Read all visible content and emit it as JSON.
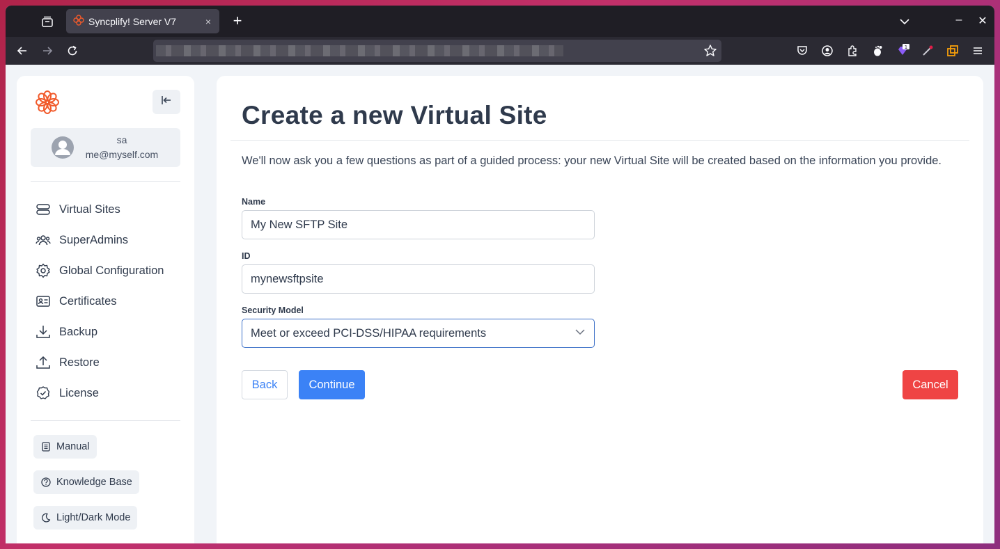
{
  "browser": {
    "tab_title": "Syncplify! Server V7",
    "tab_close": "×",
    "new_tab": "+",
    "minimize": "–",
    "close": "✕",
    "toolbar_icons": [
      "back-icon",
      "forward-icon",
      "reload-icon",
      "bookmark-star-icon",
      "pocket-icon",
      "account-icon",
      "extensions-icon",
      "gnome-icon",
      "extension-badge-icon",
      "extension-pen-icon",
      "extension-copy-icon",
      "menu-icon"
    ],
    "extension_badge": "1"
  },
  "sidebar": {
    "user": {
      "name": "sa",
      "email": "me@myself.com"
    },
    "items": [
      {
        "label": "Virtual Sites",
        "icon": "server-icon"
      },
      {
        "label": "SuperAdmins",
        "icon": "users-icon"
      },
      {
        "label": "Global Configuration",
        "icon": "gear-icon"
      },
      {
        "label": "Certificates",
        "icon": "id-card-icon"
      },
      {
        "label": "Backup",
        "icon": "download-icon"
      },
      {
        "label": "Restore",
        "icon": "upload-icon"
      },
      {
        "label": "License",
        "icon": "check-badge-icon"
      }
    ],
    "buttons": [
      {
        "label": "Manual",
        "icon": "document-icon"
      },
      {
        "label": "Knowledge Base",
        "icon": "question-icon"
      },
      {
        "label": "Light/Dark Mode",
        "icon": "moon-icon"
      }
    ]
  },
  "main": {
    "title": "Create a new Virtual Site",
    "intro": "We'll now ask you a few questions as part of a guided process: your new Virtual Site will be created based on the information you provide.",
    "fields": {
      "name": {
        "label": "Name",
        "value": "My New SFTP Site"
      },
      "id": {
        "label": "ID",
        "value": "mynewsftpsite"
      },
      "security_model": {
        "label": "Security Model",
        "value": "Meet or exceed PCI-DSS/HIPAA requirements"
      }
    },
    "buttons": {
      "back": "Back",
      "continue": "Continue",
      "cancel": "Cancel"
    }
  },
  "colors": {
    "primary": "#3b82f6",
    "danger": "#ef4444",
    "brand": "#f15a2b"
  }
}
